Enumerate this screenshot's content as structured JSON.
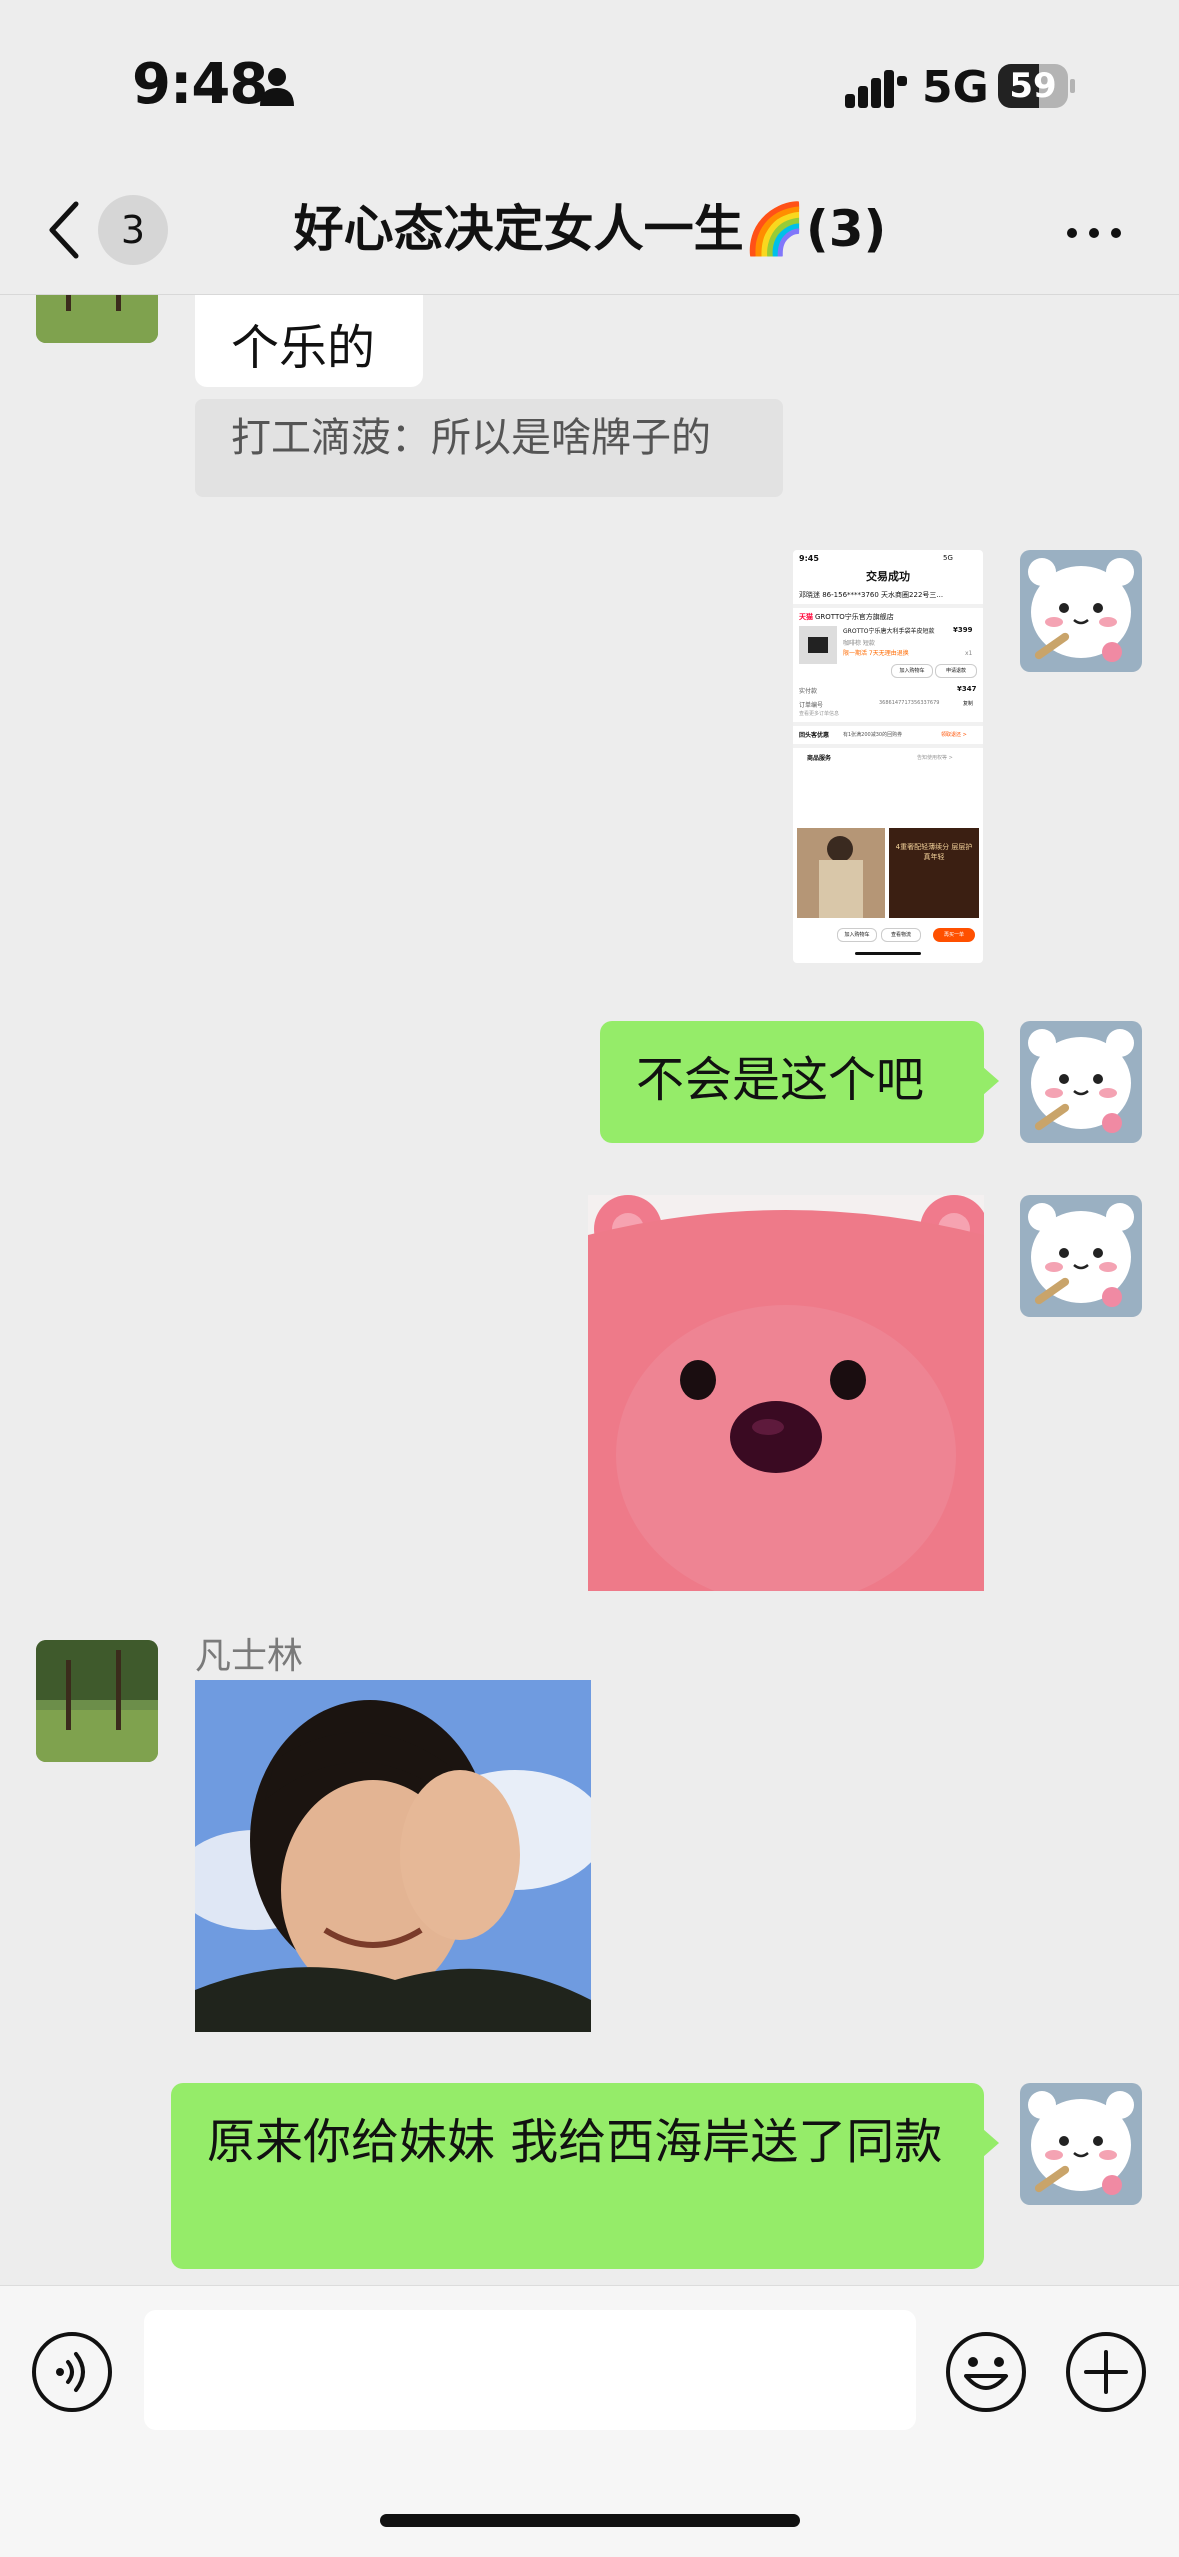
{
  "status": {
    "time": "9:48",
    "network": "5G",
    "battery": "59",
    "battery_level": 0.59
  },
  "nav": {
    "back_count": "3",
    "title": "好心态决定女人一生🌈(3)"
  },
  "messages": {
    "m1_text": "个乐的",
    "m1_quote": "打工滴菠：所以是啥牌子的",
    "m3_text": "不会是这个吧",
    "m5_sender": "凡士林",
    "m6_text": "原来你给妹妹 我给西海岸送了同款"
  },
  "screenshot": {
    "time": "9:45",
    "net": "5G",
    "header": "交易成功",
    "address": "邓晓迷 86-156****3760 天水商圈222号三...",
    "store_tag": "天猫",
    "store": "GROTTO宁乐官方旗舰店",
    "product": "GROTTO宁乐唐大利手袋羊皮短款",
    "price": "¥399",
    "spec": "咖啡棕 短款",
    "promo": "限一期活 7天无理由退换",
    "qty": "x1",
    "btn_cart": "加入购物车",
    "btn_refund": "申请退款",
    "paid_label": "实付款",
    "paid": "¥347",
    "order_label": "订单编号",
    "order_no": "3686147717356337679",
    "copy": "复制",
    "more_info": "查看更多订单信息",
    "coupon_label": "回头客优惠",
    "coupon_text": "有1张满200减30的回购券",
    "coupon_link": "领取退还 >",
    "service_label": "商品服务",
    "service_link": "告知使用权等 >",
    "ad_text": "4重奢配轻薄续分 层层护 真年轻",
    "btn_a": "加入购物车",
    "btn_b": "查看物流",
    "btn_c": "再买一单"
  },
  "colors": {
    "accent_green": "#95ec69",
    "background": "#ededed",
    "bubble_white": "#ffffff"
  },
  "icons": [
    "back-icon",
    "more-icon",
    "voice-icon",
    "emoji-icon",
    "plus-icon",
    "person-icon",
    "signal-icon",
    "battery-icon"
  ]
}
